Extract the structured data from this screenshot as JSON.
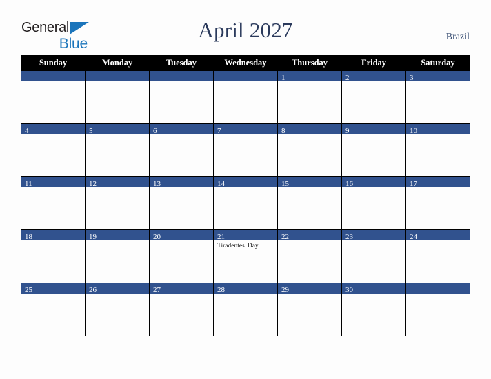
{
  "brand": {
    "name_part1": "General",
    "name_part2": "Blue",
    "triangle_icon": "blue-triangle-icon",
    "primary_color": "#1b75bb",
    "text_color": "#231f20"
  },
  "header": {
    "title": "April 2027",
    "country": "Brazil",
    "title_color": "#2b3a5c",
    "country_color": "#3c5175"
  },
  "calendar": {
    "accent_color": "#31528e",
    "header_bg": "#000000",
    "header_text_color": "#ffffff",
    "weekdays": [
      "Sunday",
      "Monday",
      "Tuesday",
      "Wednesday",
      "Thursday",
      "Friday",
      "Saturday"
    ],
    "weeks": [
      [
        {
          "day": "",
          "events": []
        },
        {
          "day": "",
          "events": []
        },
        {
          "day": "",
          "events": []
        },
        {
          "day": "",
          "events": []
        },
        {
          "day": "1",
          "events": []
        },
        {
          "day": "2",
          "events": []
        },
        {
          "day": "3",
          "events": []
        }
      ],
      [
        {
          "day": "4",
          "events": []
        },
        {
          "day": "5",
          "events": []
        },
        {
          "day": "6",
          "events": []
        },
        {
          "day": "7",
          "events": []
        },
        {
          "day": "8",
          "events": []
        },
        {
          "day": "9",
          "events": []
        },
        {
          "day": "10",
          "events": []
        }
      ],
      [
        {
          "day": "11",
          "events": []
        },
        {
          "day": "12",
          "events": []
        },
        {
          "day": "13",
          "events": []
        },
        {
          "day": "14",
          "events": []
        },
        {
          "day": "15",
          "events": []
        },
        {
          "day": "16",
          "events": []
        },
        {
          "day": "17",
          "events": []
        }
      ],
      [
        {
          "day": "18",
          "events": []
        },
        {
          "day": "19",
          "events": []
        },
        {
          "day": "20",
          "events": []
        },
        {
          "day": "21",
          "events": [
            "Tiradentes' Day"
          ]
        },
        {
          "day": "22",
          "events": []
        },
        {
          "day": "23",
          "events": []
        },
        {
          "day": "24",
          "events": []
        }
      ],
      [
        {
          "day": "25",
          "events": []
        },
        {
          "day": "26",
          "events": []
        },
        {
          "day": "27",
          "events": []
        },
        {
          "day": "28",
          "events": []
        },
        {
          "day": "29",
          "events": []
        },
        {
          "day": "30",
          "events": []
        },
        {
          "day": "",
          "events": []
        }
      ]
    ]
  }
}
